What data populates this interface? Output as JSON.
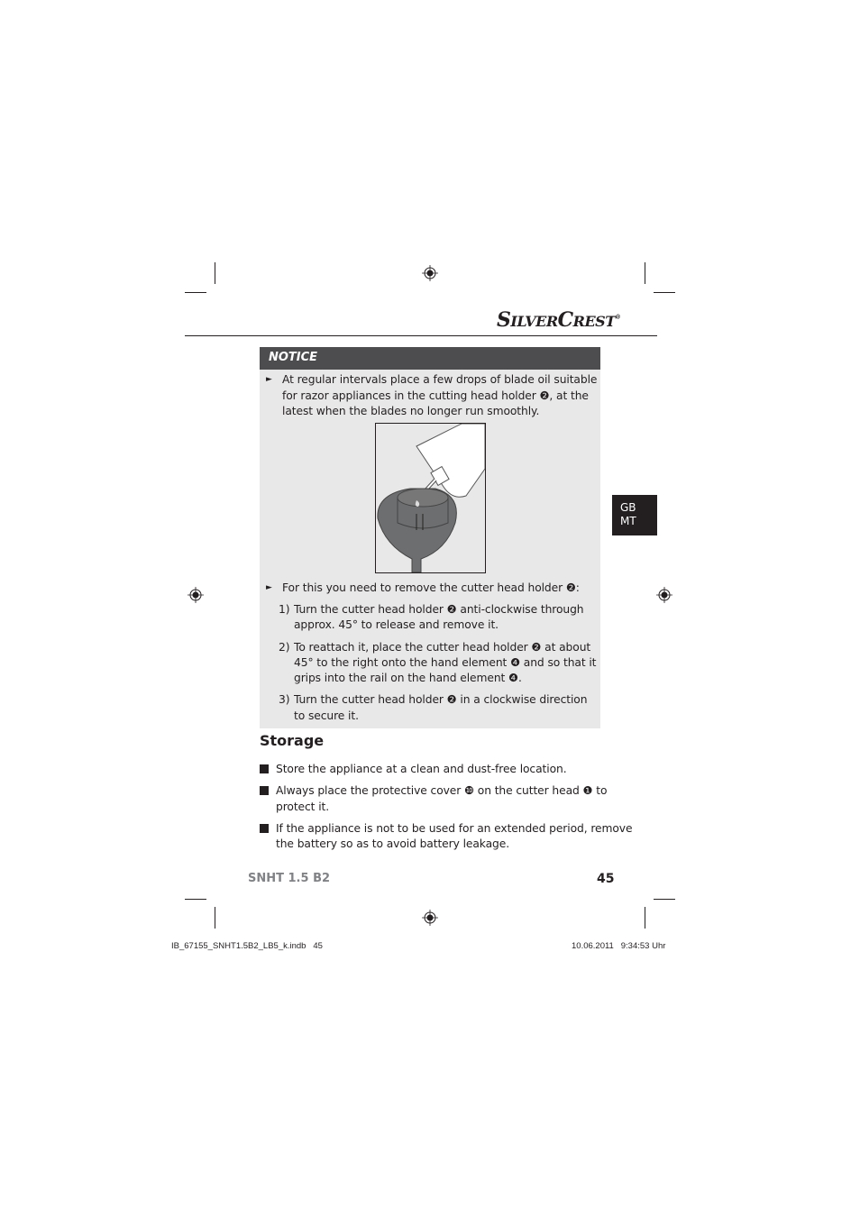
{
  "brand": {
    "logo_text": "SilverCrest",
    "registered": "®"
  },
  "notice": {
    "title": "NOTICE",
    "bullet1": [
      "At regular intervals place a few drops of blade oil suitable",
      "for razor appliances in the cutting head holder ❷, at the",
      "latest when the blades no longer run smoothly."
    ],
    "bullet2": [
      "For this you need to remove the cutter head holder ❷:"
    ],
    "steps": [
      {
        "num": "1)",
        "lines": [
          "Turn the cutter head holder ❷ anti-clockwise through",
          "approx. 45° to release and remove it."
        ]
      },
      {
        "num": "2)",
        "lines": [
          "To reattach it, place the cutter head holder ❷ at about",
          "45° to the right onto the hand element ❹ and so that it",
          "grips into the rail on the hand element ❹."
        ]
      },
      {
        "num": "3)",
        "lines": [
          "Turn the cutter head holder ❷ in a clockwise direction",
          "to secure it."
        ]
      }
    ]
  },
  "storage": {
    "title": "Storage",
    "items": [
      [
        "Store the appliance at a clean and dust-free location."
      ],
      [
        "Always place the protective cover ❿ on the cutter head ❶ to",
        "protect it."
      ],
      [
        "If the appliance is not to be used for an extended period, remove",
        "the battery so as to avoid battery leakage."
      ]
    ]
  },
  "language_tab": {
    "line1": "GB",
    "line2": "MT"
  },
  "footer": {
    "model": "SNHT 1.5 B2",
    "page_number": "45"
  },
  "slug": {
    "file": "IB_67155_SNHT1.5B2_LB5_k.indb   45",
    "date": "10.06.2011   9:34:53 Uhr"
  }
}
